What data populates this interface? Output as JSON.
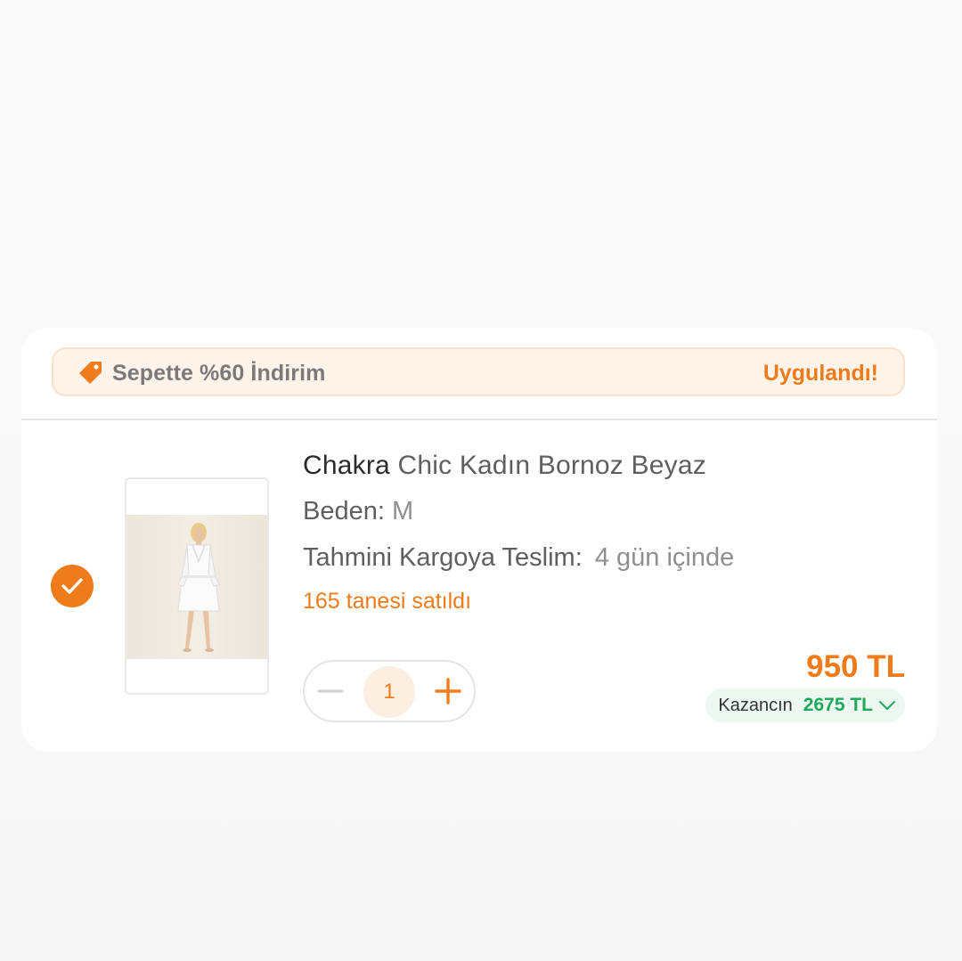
{
  "promo": {
    "icon": "tag-icon",
    "text": "Sepette %60 İndirim",
    "status": "Uygulandı!"
  },
  "product": {
    "selected": true,
    "brand": "Chakra",
    "name": "Chic Kadın Bornoz Beyaz",
    "size_label": "Beden:",
    "size_value": "M",
    "delivery_label": "Tahmini Kargoya Teslim:",
    "delivery_value": "4 gün içinde",
    "sold_text": "165 tanesi satıldı",
    "quantity": "1",
    "price": "950 TL",
    "savings_label": "Kazancın",
    "savings_amount": "2675 TL"
  },
  "colors": {
    "accent": "#ef7b1a",
    "success": "#1fa85a",
    "promo_bg": "#fff3ea"
  }
}
